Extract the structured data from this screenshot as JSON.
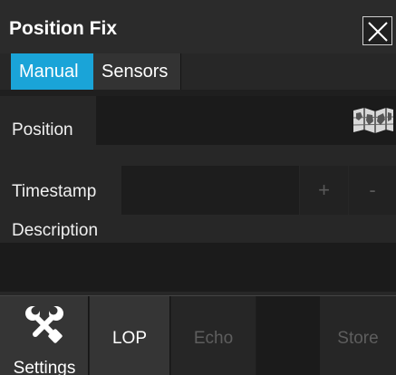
{
  "window": {
    "title": "Position Fix",
    "close_icon": "close-icon"
  },
  "tabs": [
    {
      "label": "Manual",
      "active": true
    },
    {
      "label": "Sensors",
      "active": false
    }
  ],
  "form": {
    "position_label": "Position",
    "position_value": "",
    "map_icon": "map-icon",
    "timestamp_label": "Timestamp",
    "timestamp_value": "",
    "plus_label": "+",
    "minus_label": "-",
    "description_label": "Description",
    "description_value": ""
  },
  "toolbar": {
    "settings_label": "Settings",
    "settings_icon": "tools-icon",
    "lop_label": "LOP",
    "echo_label": "Echo",
    "store_label": "Store",
    "echo_enabled": false,
    "store_enabled": false
  },
  "colors": {
    "accent": "#1aa4d8",
    "background": "#272727",
    "disabled_text": "#5e5e5e"
  }
}
